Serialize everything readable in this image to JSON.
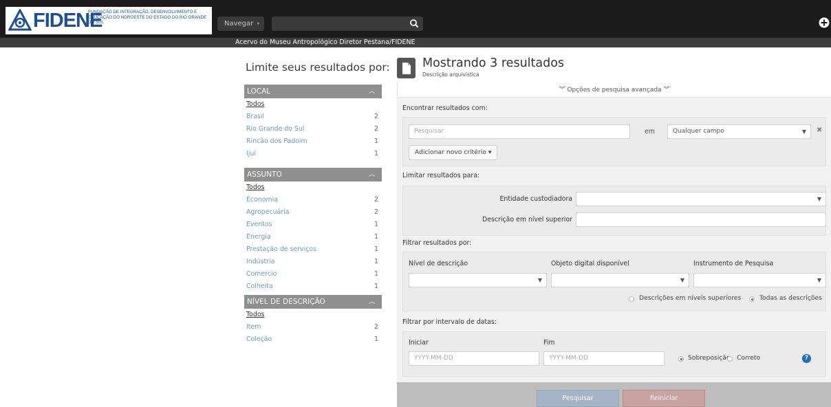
{
  "header": {
    "logo_word": "FIDENE",
    "logo_subtitle": "Fundação de Integração, Desenvolvimento e Educação do Noroeste do Estado do Rio Grande do Sul",
    "nav_label": "Navegar",
    "search_value": "",
    "subtitle": "Acervo do Museu Antropológico Diretor Pestana/FIDENE"
  },
  "sidebar": {
    "title": "Limite seus resultados por:",
    "facets": [
      {
        "heading": "LOCAL",
        "all_label": "Todos",
        "items": [
          {
            "label": "Brasil",
            "count": "2"
          },
          {
            "label": "Rio Grande do Sul",
            "count": "2"
          },
          {
            "label": "Rincão dos Padoim",
            "count": "1"
          },
          {
            "label": "Ijuí",
            "count": "1"
          }
        ]
      },
      {
        "heading": "ASSUNTO",
        "all_label": "Todos",
        "items": [
          {
            "label": "Economia",
            "count": "2"
          },
          {
            "label": "Agropecuária",
            "count": "2"
          },
          {
            "label": "Eventos",
            "count": "1"
          },
          {
            "label": "Energia",
            "count": "1"
          },
          {
            "label": "Prestação de serviços",
            "count": "1"
          },
          {
            "label": "Indústria",
            "count": "1"
          },
          {
            "label": "Comercio",
            "count": "1"
          },
          {
            "label": "Colheita",
            "count": "1"
          }
        ]
      },
      {
        "heading": "NÍVEL DE DESCRIÇÃO",
        "all_label": "Todos",
        "items": [
          {
            "label": "Item",
            "count": "2"
          },
          {
            "label": "Coleção",
            "count": "1"
          }
        ]
      }
    ]
  },
  "main": {
    "title": "Mostrando 3 resultados",
    "subtitle": "Descrição arquivística",
    "advanced_toggle": "Opções de pesquisa avançada",
    "find_label": "Encontrar resultados com:",
    "search_placeholder": "Pesquisar",
    "em_label": "em",
    "field_select": "Qualquer campo",
    "add_criteria": "Adicionar novo critério",
    "limit_label": "Limitar resultados para:",
    "repository_label": "Entidade custodiadora",
    "repository_value": "",
    "parent_label": "Descrição em nível superior",
    "parent_value": "",
    "filter_label": "Filtrar resultados por:",
    "level_label": "Nível de descrição",
    "digital_label": "Objeto digital disponível",
    "finding_aid_label": "Instrumento de Pesquisa",
    "radio_top_level": "Descrições em níveis superiores",
    "radio_all": "Todas as descrições",
    "date_filter_label": "Filtrar por intervalo de datas:",
    "start_label": "Iniciar",
    "end_label": "Fim",
    "date_placeholder": "YYYY-MM-DD",
    "radio_overlap": "Sobreposição",
    "radio_exact": "Correto",
    "search_button": "Pesquisar",
    "reset_button": "Reiniciar"
  },
  "colors": {
    "topbar": "#1b1b1b",
    "logo_blue": "#1d4f91",
    "facet_header": "#8f8f8f",
    "link": "#6f98c4",
    "search_button": "#a7b4c7",
    "reset_button": "#c9a2a2",
    "help_icon": "#1f6fb3"
  }
}
